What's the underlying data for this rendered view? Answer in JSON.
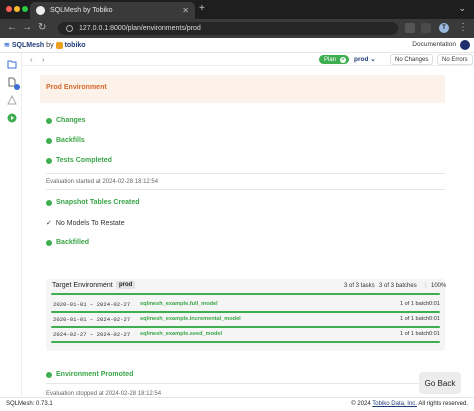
{
  "browser": {
    "tab_title": "SQLMesh by Tobiko",
    "url": "127.0.0.1:8000/plan/environments/prod",
    "profile_initial": "T"
  },
  "app": {
    "logo_sql": "SQLMesh",
    "logo_by": "by",
    "logo_tobiko": "tobiko",
    "docs_link": "Documentation"
  },
  "toolbar": {
    "plan_label": "Plan",
    "env_value": "prod",
    "no_changes": "No Changes",
    "no_errors": "No Errors"
  },
  "plan": {
    "banner": "Prod Environment",
    "steps": {
      "changes": "Changes",
      "backfills": "Backfills",
      "tests": "Tests Completed",
      "eval_started": "Evaluation started at 2024-02-28 18:12:54",
      "snapshot": "Snapshot Tables Created",
      "no_restate": "No Models To Restate",
      "backfilled": "Backfilled",
      "promoted": "Environment Promoted",
      "eval_stopped": "Evaluation stopped at 2024-02-28 18:12:54"
    },
    "target": {
      "title": "Target Environment",
      "env": "prod",
      "tasks": "3 of 3 tasks",
      "batches": "3 of 3 batches",
      "percent": "100%",
      "progress": 1.0,
      "rows": [
        {
          "dates": "2020-01-01 – 2024-02-27",
          "model": "sqlmesh_example.full_model",
          "batch": "1 of 1 batch",
          "dur": "0:01"
        },
        {
          "dates": "2020-01-01 – 2024-02-27",
          "model": "sqlmesh_example.incremental_model",
          "batch": "1 of 1 batch",
          "dur": "0:01"
        },
        {
          "dates": "2024-02-27 – 2024-02-27",
          "model": "sqlmesh_example.seed_model",
          "batch": "1 of 1 batch",
          "dur": "0:01"
        }
      ]
    },
    "go_back": "Go Back"
  },
  "footer": {
    "version": "SQLMesh: 0.73.1",
    "copyright_prefix": "© 2024",
    "company": "Tobiko Data, Inc.",
    "rights": "All rights reserved."
  },
  "colors": {
    "accent_green": "#3fae4f",
    "banner_orange": "#d4682a",
    "brand_blue": "#1f3b7a"
  },
  "icons": [
    "chevron-left-icon",
    "chevron-right-icon",
    "refresh-icon",
    "info-icon",
    "folder-icon",
    "document-icon",
    "warning-icon",
    "play-icon",
    "close-icon",
    "menu-icon"
  ]
}
